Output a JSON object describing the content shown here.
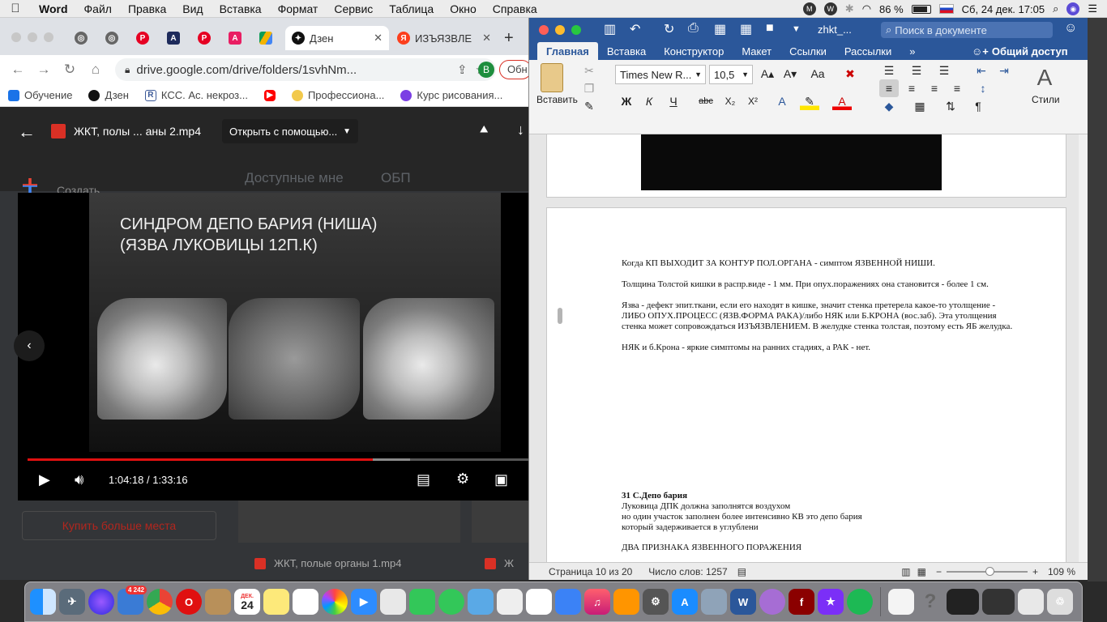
{
  "menubar": {
    "app": "Word",
    "items": [
      "Файл",
      "Правка",
      "Вид",
      "Вставка",
      "Формат",
      "Сервис",
      "Таблица",
      "Окно",
      "Справка"
    ],
    "battery": "86 %",
    "battery_level": 0.86,
    "datetime": "Сб, 24 дек.  17:05"
  },
  "chrome": {
    "tabs": [
      {
        "label": "",
        "icon": "globe-icon"
      },
      {
        "label": "",
        "icon": "globe-icon"
      },
      {
        "label": "",
        "icon": "pinterest-icon"
      },
      {
        "label": "",
        "icon": "a-icon"
      },
      {
        "label": "",
        "icon": "pinterest-icon"
      },
      {
        "label": "",
        "icon": "a-icon"
      },
      {
        "label": "",
        "icon": "drive-icon"
      },
      {
        "label": "Дзен",
        "icon": "dzen-icon"
      },
      {
        "label": "ИЗЪЯЗВЛЕ",
        "icon": "yandex-icon"
      }
    ],
    "url": "drive.google.com/drive/folders/1svhNm...",
    "profile": "В",
    "side_button": "Обн",
    "bookmarks": [
      {
        "label": "Обучение",
        "color": "#1a73e8"
      },
      {
        "label": "Дзен",
        "color": "#111111"
      },
      {
        "label": "КСС. Ас. некроз...",
        "color": "#3b5998"
      },
      {
        "label": "",
        "color": "#ff0000"
      },
      {
        "label": "Профессиона...",
        "color": "#f2c94c"
      },
      {
        "label": "Курс рисования...",
        "color": "#7b3fe4"
      }
    ]
  },
  "viewer": {
    "file_title": "ЖКТ, полы ... аны 2.mp4",
    "open_with": "Открыть с помощью...",
    "slide_title_line1": "СИНДРОМ ДЕПО БАРИЯ (НИША)",
    "slide_title_line2": "(ЯЗВА ЛУКОВИЦЫ 12П.К)",
    "time": "1:04:18 / 1:33:16",
    "progress": 0.69
  },
  "drive": {
    "side_label": "Создать",
    "header_left": "Доступные мне",
    "header_right": "ОБП",
    "buy_more": "Купить больше места",
    "file1": "ЖКТ, полые органы 1.mp4",
    "file2": "Ж"
  },
  "word": {
    "filename": "zhkt_...",
    "search_placeholder": "Поиск в документе",
    "tabs": [
      "Главная",
      "Вставка",
      "Конструктор",
      "Макет",
      "Ссылки",
      "Рассылки"
    ],
    "share": "Общий доступ",
    "font": "Times New R...",
    "size": "10,5",
    "paste_label": "Вставить",
    "styles_label": "Стили",
    "doc_lines": [
      "Когда КП ВЫХОДИТ ЗА КОНТУР ПОЛ.ОРГАНА - симптом ЯЗВЕННОЙ НИШИ.",
      "Толщина Толстой кишки в распр.виде - 1 мм. При опух.поражениях она становится - более 1 см.",
      "Язва - дефект эпит.ткани, если его находят в кишке, значит стенка претерела какое-то утолщение -",
      "ЛИБО ОПУХ.ПРОЦЕСС (ЯЗВ.ФОРМА РАКА)/либо НЯК или Б.КРОНА (вос.заб). Эта утолщения",
      "стенка может сопровождаться ИЗЪЯЗВЛЕНИЕМ. В желудке стенка толстая, поэтому есть ЯБ желудка.",
      "НЯК и б.Крона - яркие симптомы на ранних стадиях, а РАК - нет."
    ],
    "section_title": "31 С.Депо бария",
    "section_lines": [
      "Луковица ДПК должна заполнятся воздухом",
      "но один участок заполнен более интенсивно КВ это депо бария",
      "который задерживается в углублени",
      "ДВА ПРИЗНАКА ЯЗВЕННОГО ПОРАЖЕНИЯ"
    ],
    "status_page": "Страница 10 из 20",
    "status_words": "Число слов: 1257",
    "zoom": "109 %"
  },
  "dock": {
    "badge": "4 242",
    "calendar_month": "ДЕК.",
    "calendar_day": "24"
  }
}
